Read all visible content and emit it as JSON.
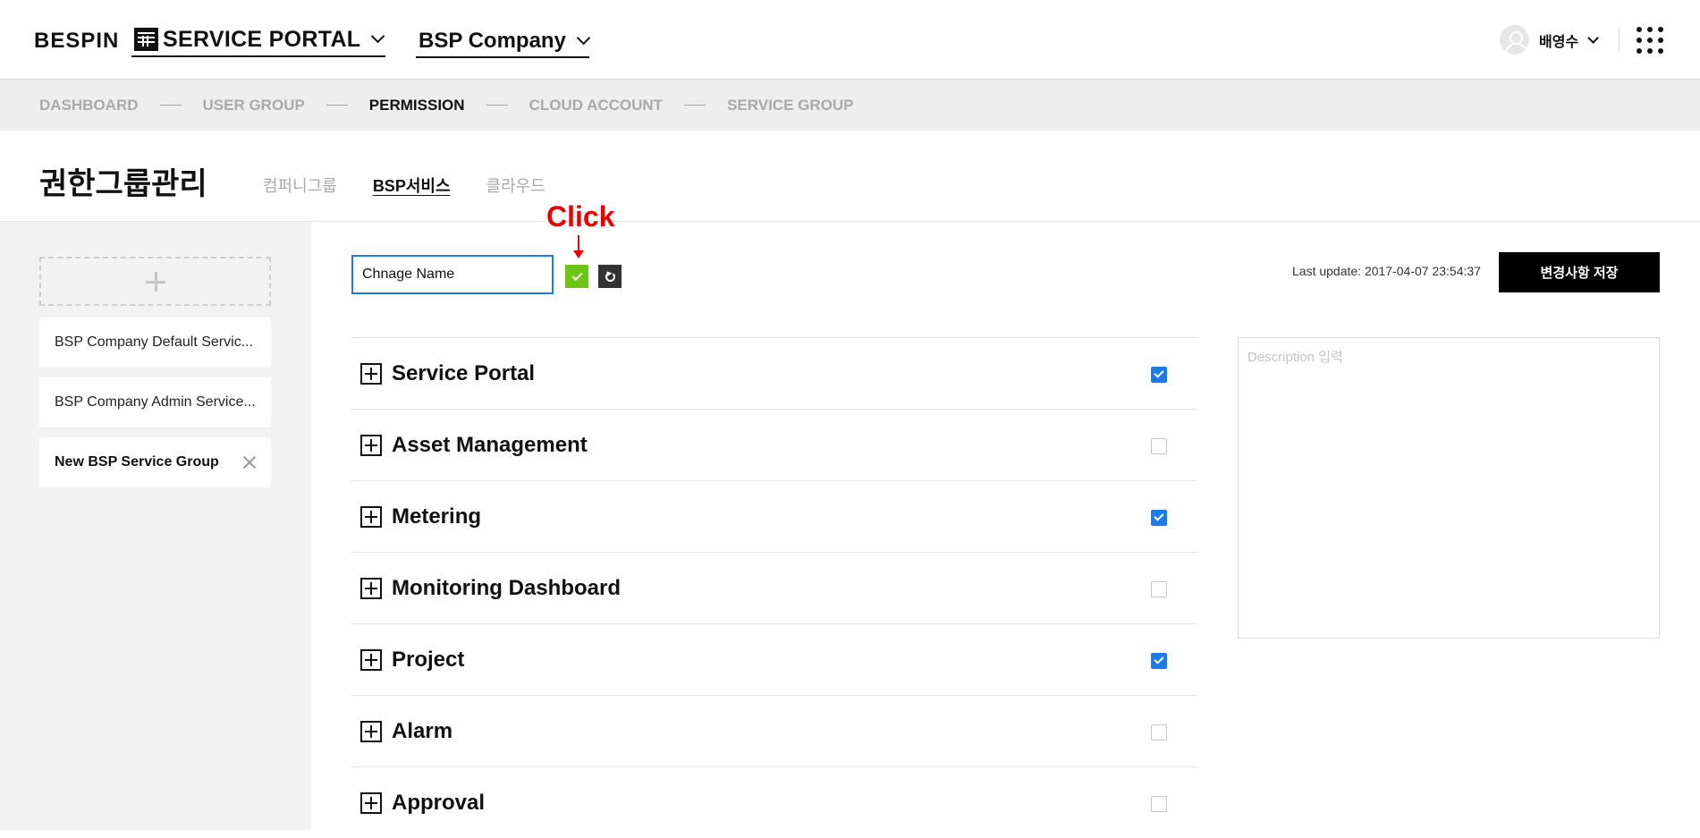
{
  "header": {
    "logo": "BESPIN",
    "portal_label": "SERVICE PORTAL",
    "company_label": "BSP Company",
    "user_name": "배영수"
  },
  "stepnav": {
    "steps": [
      {
        "label": "DASHBOARD",
        "active": false
      },
      {
        "label": "USER GROUP",
        "active": false
      },
      {
        "label": "PERMISSION",
        "active": true
      },
      {
        "label": "CLOUD ACCOUNT",
        "active": false
      },
      {
        "label": "SERVICE GROUP",
        "active": false
      }
    ]
  },
  "page": {
    "title": "권한그룹관리",
    "tabs": [
      {
        "label": "컴퍼니그룹",
        "active": false
      },
      {
        "label": "BSP서비스",
        "active": true
      },
      {
        "label": "클라우드",
        "active": false
      }
    ]
  },
  "sidebar": {
    "groups": [
      {
        "label": "BSP Company Default Servic...",
        "active": false
      },
      {
        "label": "BSP Company Admin Service...",
        "active": false
      },
      {
        "label": "New BSP Service Group",
        "active": true
      }
    ]
  },
  "editor": {
    "name_value": "Chnage Name",
    "annotation": "Click",
    "last_update": "Last update: 2017-04-07 23:54:37",
    "save_label": "변경사항 저장",
    "description_placeholder": "Description 입력"
  },
  "permissions": [
    {
      "label": "Service Portal",
      "checked": true
    },
    {
      "label": "Asset Management",
      "checked": false
    },
    {
      "label": "Metering",
      "checked": true
    },
    {
      "label": "Monitoring Dashboard",
      "checked": false
    },
    {
      "label": "Project",
      "checked": true
    },
    {
      "label": "Alarm",
      "checked": false
    },
    {
      "label": "Approval",
      "checked": false
    }
  ],
  "colors": {
    "accent": "#1e7ae6",
    "confirm": "#6cc417",
    "annotation": "#e60000"
  }
}
